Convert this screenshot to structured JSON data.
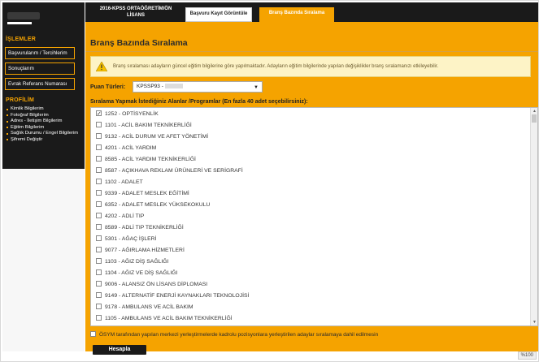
{
  "sidebar": {
    "islemler_title": "İŞLEMLER",
    "buttons": [
      {
        "label": "Başvurularım / Tercihlerim"
      },
      {
        "label": "Sonuçlarım"
      },
      {
        "label": "Evrak Referans Numarası"
      }
    ],
    "profil_title": "PROFİLİM",
    "profile_items": [
      "Kimlik Bilgilerim",
      "Fotoğraf Bilgilerim",
      "Adres - İletişim Bilgilerim",
      "Eğitim Bilgilerim",
      "Sağlık Durumu / Engel Bilgilerim",
      "Şifremi Değiştir"
    ]
  },
  "tabs": [
    {
      "label": "2016-KPSS ORTAÖĞRETİM/ÖN LİSANS"
    },
    {
      "label": "Başvuru Kayıt Görüntüle"
    },
    {
      "label": "Branş Bazında Sıralama"
    }
  ],
  "page_title": "Branş Bazında Sıralama",
  "notice": "Branş sıralaması adayların güncel eğitim bilgilerine göre yapılmaktadır. Adayların eğitim bilgilerinde yapılan değişiklikler branş sıralamanızı etkileyebilir.",
  "puan": {
    "label": "Puan Türleri:",
    "value": "KPSSP93 -"
  },
  "list_heading": "Sıralama Yapmak İstediğiniz Alanlar /Programlar (En fazla 40 adet seçebilirsiniz):",
  "options": [
    {
      "label": "1252 - OPTİSYENLİK",
      "checked": true
    },
    {
      "label": "1101 - ACİL BAKIM TEKNİKERLİĞİ",
      "checked": false
    },
    {
      "label": "9132 - ACİL DURUM VE AFET YÖNETİMİ",
      "checked": false
    },
    {
      "label": "4201 - ACİL YARDIM",
      "checked": false
    },
    {
      "label": "8585 - ACİL YARDIM TEKNİKERLİĞİ",
      "checked": false
    },
    {
      "label": "8587 - AÇIKHAVA REKLAM ÜRÜNLERİ VE SERİGRAFİ",
      "checked": false
    },
    {
      "label": "1102 - ADALET",
      "checked": false
    },
    {
      "label": "9339 - ADALET MESLEK EĞİTİMİ",
      "checked": false
    },
    {
      "label": "6352 - ADALET MESLEK YÜKSEKOKULU",
      "checked": false
    },
    {
      "label": "4202 - ADLİ TIP",
      "checked": false
    },
    {
      "label": "8589 - ADLİ TIP TEKNİKERLİĞİ",
      "checked": false
    },
    {
      "label": "5301 - AĞAÇ İŞLERİ",
      "checked": false
    },
    {
      "label": "9077 - AĞIRLAMA HİZMETLERİ",
      "checked": false
    },
    {
      "label": "1103 - AĞIZ DİŞ SAĞLIĞI",
      "checked": false
    },
    {
      "label": "1104 - AĞIZ VE DİŞ SAĞLIĞI",
      "checked": false
    },
    {
      "label": "9006 - ALANSIZ ÖN LİSANS DİPLOMASI",
      "checked": false
    },
    {
      "label": "9149 - ALTERNATİF ENERJİ KAYNAKLARI TEKNOLOJİSİ",
      "checked": false
    },
    {
      "label": "9178 - AMBULANS VE ACİL BAKIM",
      "checked": false
    },
    {
      "label": "1105 - AMBULANS VE ACİL BAKIM TEKNİKERLİĞİ",
      "checked": false
    }
  ],
  "bottom_checkbox": "ÖSYM tarafından yapılan merkezi yerleştirmelerde kadrolu pozisyonlara yerleştirilen adaylar sıralamaya dahil edilmesin",
  "hesapla_label": "Hesapla",
  "zoom": "%100",
  "colors": {
    "accent": "#f5a300",
    "dark": "#1a1a1a"
  }
}
